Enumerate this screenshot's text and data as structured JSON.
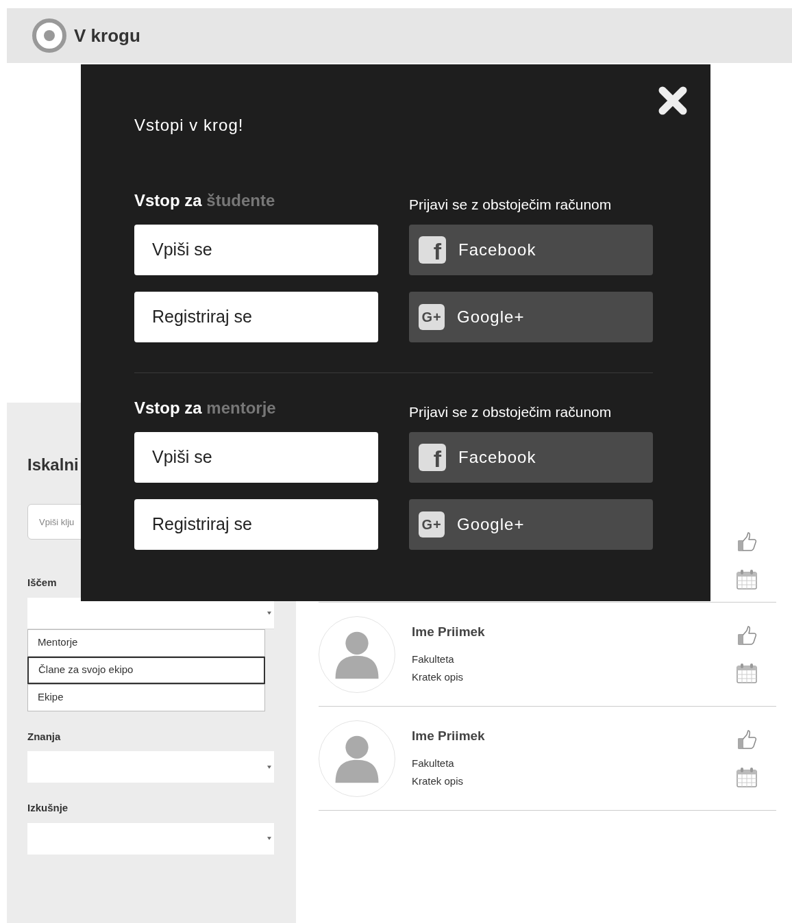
{
  "header": {
    "title": "V krogu"
  },
  "modal": {
    "title": "Vstopi v krog!",
    "sections": [
      {
        "heading": "Vstop za",
        "highlight": "študente",
        "buttons": [
          "Vpiši se",
          "Registriraj se"
        ],
        "social_title": "Prijavi se z obstoječim računom",
        "social": [
          {
            "kind": "facebook",
            "icon_text": "f",
            "label": "Facebook"
          },
          {
            "kind": "google",
            "icon_text": "G+",
            "label": "Google+"
          }
        ]
      },
      {
        "heading": "Vstop za",
        "highlight": "mentorje",
        "buttons": [
          "Vpiši se",
          "Registriraj se"
        ],
        "social_title": "Prijavi se z obstoječim računom",
        "social": [
          {
            "kind": "facebook",
            "icon_text": "f",
            "label": "Facebook"
          },
          {
            "kind": "google",
            "icon_text": "G+",
            "label": "Google+"
          }
        ]
      }
    ]
  },
  "search_panel": {
    "title": "Iskalni",
    "search": {
      "placeholder": "Vpiši klju"
    },
    "filters": [
      {
        "label": "Iščem",
        "expanded": true,
        "options": [
          {
            "label": "Mentorje",
            "selected": false
          },
          {
            "label": "Člane za svojo ekipo",
            "selected": true
          },
          {
            "label": "Ekipe",
            "selected": false
          }
        ]
      },
      {
        "label": "Znanja",
        "expanded": false
      },
      {
        "label": "Izkušnje",
        "expanded": false
      }
    ]
  },
  "results": [
    {
      "kind": "covered"
    },
    {
      "kind": "person",
      "name": "Ime Priimek",
      "faculty": "Fakulteta",
      "description": "Kratek opis"
    },
    {
      "kind": "person",
      "name": "Ime Priimek",
      "faculty": "Fakulteta",
      "description": "Kratek opis"
    }
  ]
}
